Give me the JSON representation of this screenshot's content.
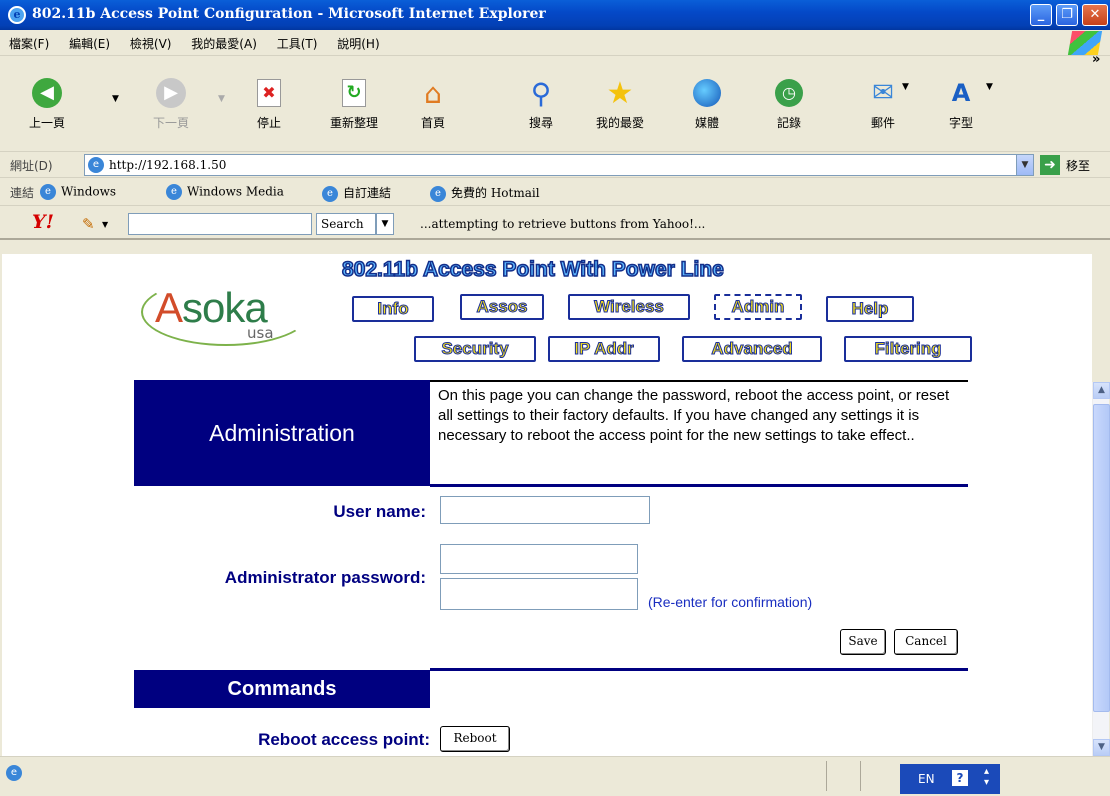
{
  "window": {
    "title": "802.11b Access Point Configuration - Microsoft Internet Explorer",
    "controls": [
      "minimize",
      "maximize",
      "close"
    ]
  },
  "menu": [
    "檔案(F)",
    "編輯(E)",
    "檢視(V)",
    "我的最愛(A)",
    "工具(T)",
    "說明(H)"
  ],
  "toolbar": {
    "back": "上一頁",
    "forward": "下一頁",
    "stop": "停止",
    "refresh": "重新整理",
    "home": "首頁",
    "search": "搜尋",
    "favorites": "我的最愛",
    "media": "媒體",
    "history": "記錄",
    "mail": "郵件",
    "font": "字型",
    "more": "»"
  },
  "address": {
    "label": "網址(D)",
    "url": "http://192.168.1.50",
    "go": "移至"
  },
  "links": {
    "label": "連結",
    "items": [
      "Windows",
      "Windows Media",
      "自訂連結",
      "免費的 Hotmail"
    ]
  },
  "yahoo": {
    "logo": "Y!",
    "search_button": "Search",
    "status": "...attempting to retrieve buttons from Yahoo!..."
  },
  "page": {
    "logo_text": "Asoka",
    "logo_sub": "usa",
    "banner": "802.11b Access Point With Power Line",
    "nav_row1": [
      "Info",
      "Assos",
      "Wireless",
      "Admin",
      "Help"
    ],
    "nav_row2": [
      "Security",
      "IP Addr",
      "Advanced",
      "Filtering"
    ],
    "active_nav": "Admin",
    "section_title": "Administration",
    "description": "On this page you can change the password, reboot the access point, or reset all settings to their factory defaults. If you have changed any settings it is necessary to reboot the access point for the new settings to take effect..",
    "username_label": "User name:",
    "username_value": "",
    "password_label": "Administrator password:",
    "password_value": "",
    "confirm_value": "",
    "reenter_note": "(Re-enter for confirmation)",
    "save": "Save",
    "cancel": "Cancel",
    "commands_title": "Commands",
    "reboot_label": "Reboot access point:",
    "reboot_button": "Reboot"
  },
  "statusbar": {
    "lang": "EN",
    "help": "?"
  },
  "colors": {
    "header_blue": "#000080",
    "nav_text": "#f2dd1a",
    "label_blue": "#000080",
    "titlebar": "#0449c8"
  }
}
